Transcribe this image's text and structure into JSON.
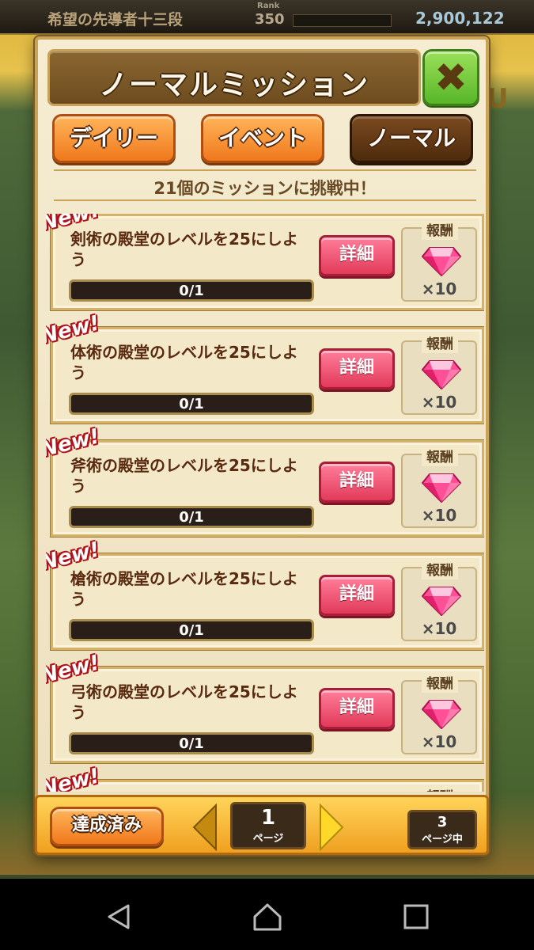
{
  "background": {
    "player_title": "希望の先導者十三段",
    "rank_label": "Rank",
    "rank_value": "350",
    "gem_count": "2,900,122",
    "side_letter": "U"
  },
  "modal": {
    "title": "ノーマルミッション",
    "close_icon": "close-icon",
    "tabs": [
      {
        "label": "デイリー",
        "active": false
      },
      {
        "label": "イベント",
        "active": false
      },
      {
        "label": "ノーマル",
        "active": true
      }
    ],
    "banner": "21個のミッションに挑戦中！"
  },
  "missions": [
    {
      "new": "New!",
      "text": "剣術の殿堂のレベルを25にしよう",
      "progress": "0/1",
      "detail": "詳細",
      "reward_label": "報酬",
      "reward_count": "×10"
    },
    {
      "new": "New!",
      "text": "体術の殿堂のレベルを25にしよう",
      "progress": "0/1",
      "detail": "詳細",
      "reward_label": "報酬",
      "reward_count": "×10"
    },
    {
      "new": "New!",
      "text": "斧術の殿堂のレベルを25にしよう",
      "progress": "0/1",
      "detail": "詳細",
      "reward_label": "報酬",
      "reward_count": "×10"
    },
    {
      "new": "New!",
      "text": "槍術の殿堂のレベルを25にしよう",
      "progress": "0/1",
      "detail": "詳細",
      "reward_label": "報酬",
      "reward_count": "×10"
    },
    {
      "new": "New!",
      "text": "弓術の殿堂のレベルを25にしよう",
      "progress": "0/1",
      "detail": "詳細",
      "reward_label": "報酬",
      "reward_count": "×10"
    },
    {
      "new": "New!",
      "text": "",
      "progress": "",
      "detail": "",
      "reward_label": "報酬",
      "reward_count": ""
    }
  ],
  "pagination": {
    "completed_label": "達成済み",
    "current_page": "1",
    "page_unit": "ページ",
    "total_pages": "3",
    "total_unit": "ページ中"
  },
  "colors": {
    "accent_orange": "#f0781c",
    "detail_pink": "#e23a5a",
    "close_green": "#58b628",
    "gem_pink": "#ff3a8a"
  }
}
